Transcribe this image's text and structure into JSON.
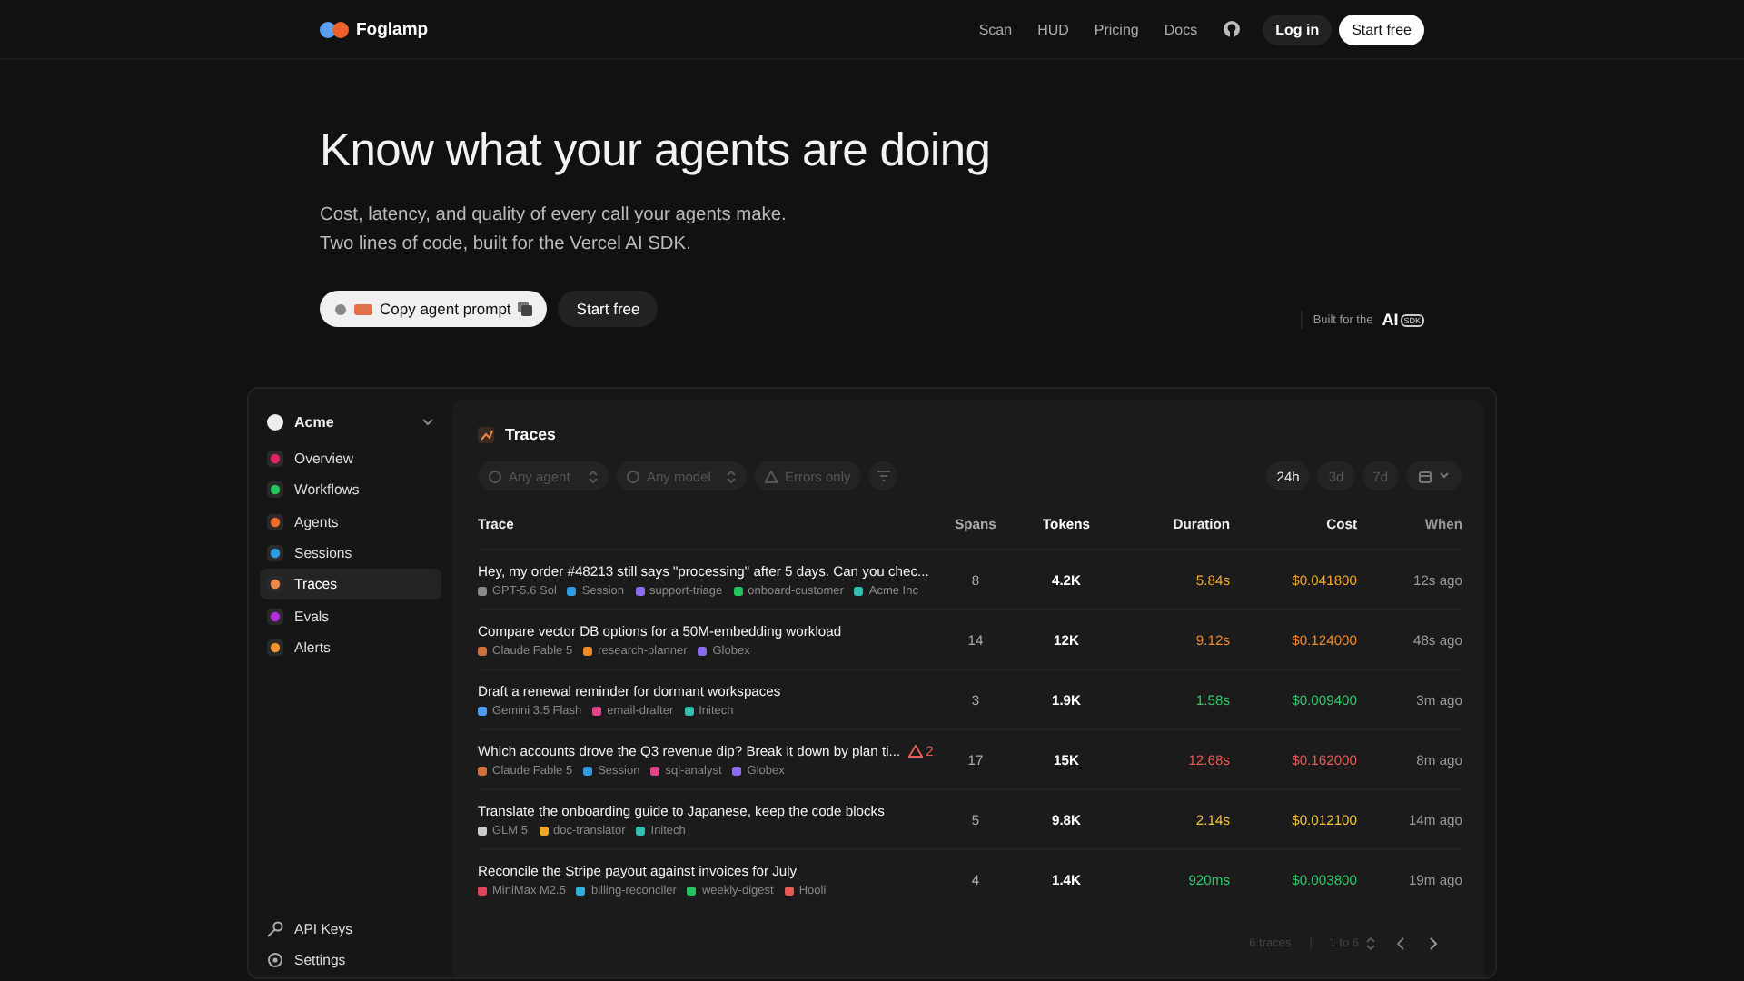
{
  "nav": {
    "brand": "Foglamp",
    "links": [
      "Scan",
      "HUD",
      "Pricing",
      "Docs"
    ],
    "login": "Log in",
    "start": "Start free"
  },
  "hero": {
    "title": "Know what your agents are doing",
    "subtitle": "Cost, latency, and quality of every call your agents make. Two lines of code, built for the Vercel AI SDK.",
    "copy_button": "Copy agent prompt",
    "start_button": "Start free",
    "built_for": "Built for the",
    "sdk_logo": "AI",
    "sdk_badge": "SDK"
  },
  "sidebar": {
    "workspace": "Acme",
    "items": [
      {
        "label": "Overview",
        "color": "#e0245e",
        "selected": false
      },
      {
        "label": "Workflows",
        "color": "#22c55e",
        "selected": false
      },
      {
        "label": "Agents",
        "color": "#f06a2a",
        "selected": false
      },
      {
        "label": "Sessions",
        "color": "#2f9be0",
        "selected": false
      },
      {
        "label": "Traces",
        "color": "#e8884a",
        "selected": true
      },
      {
        "label": "Evals",
        "color": "#b02fd8",
        "selected": false
      },
      {
        "label": "Alerts",
        "color": "#f0932a",
        "selected": false
      }
    ],
    "bottom": [
      "API Keys",
      "Settings"
    ]
  },
  "traces": {
    "title": "Traces",
    "filters": [
      "Any agent",
      "Any model",
      "Errors only"
    ],
    "ranges": [
      {
        "label": "24h",
        "selected": true
      },
      {
        "label": "3d",
        "selected": false
      },
      {
        "label": "7d",
        "selected": false
      }
    ],
    "columns": [
      "Trace",
      "Spans",
      "Tokens",
      "Duration",
      "Cost",
      "When"
    ],
    "rows": [
      {
        "title": "Hey, my order #48213 still says \"processing\" after 5 days. Can you chec...",
        "tags": [
          {
            "label": "GPT-5.6 Sol",
            "color": "#8a8a8a"
          },
          {
            "label": "Session",
            "color": "#2f9be0"
          },
          {
            "label": "support-triage",
            "color": "#8b6cf0"
          },
          {
            "label": "onboard-customer",
            "color": "#22c55e"
          },
          {
            "label": "Acme Inc",
            "color": "#2fc0b0"
          }
        ],
        "spans": "8",
        "tokens": "4.2K",
        "duration": "5.84s",
        "cost": "$0.041800",
        "when": "12s ago",
        "color": "#f0a62a"
      },
      {
        "title": "Compare vector DB options for a 50M-embedding workload",
        "tags": [
          {
            "label": "Claude Fable 5",
            "color": "#d0703a"
          },
          {
            "label": "research-planner",
            "color": "#f08a2a"
          },
          {
            "label": "Globex",
            "color": "#8b6cf0"
          }
        ],
        "spans": "14",
        "tokens": "12K",
        "duration": "9.12s",
        "cost": "$0.124000",
        "when": "48s ago",
        "color": "#ec8a30"
      },
      {
        "title": "Draft a renewal reminder for dormant workspaces",
        "tags": [
          {
            "label": "Gemini 3.5 Flash",
            "color": "#4a9cf0"
          },
          {
            "label": "email-drafter",
            "color": "#e0458a"
          },
          {
            "label": "Initech",
            "color": "#2fc0b0"
          }
        ],
        "spans": "3",
        "tokens": "1.9K",
        "duration": "1.58s",
        "cost": "$0.009400",
        "when": "3m ago",
        "color": "#34c46a"
      },
      {
        "title": "Which accounts drove the Q3 revenue dip? Break it down by plan ti...",
        "warning": "2",
        "tags": [
          {
            "label": "Claude Fable 5",
            "color": "#d0703a"
          },
          {
            "label": "Session",
            "color": "#2f9be0"
          },
          {
            "label": "sql-analyst",
            "color": "#e0458a"
          },
          {
            "label": "Globex",
            "color": "#8b6cf0"
          }
        ],
        "spans": "17",
        "tokens": "15K",
        "duration": "12.68s",
        "cost": "$0.162000",
        "when": "8m ago",
        "color": "#e85a55"
      },
      {
        "title": "Translate the onboarding guide to Japanese, keep the code blocks",
        "tags": [
          {
            "label": "GLM 5",
            "color": "#cccccc"
          },
          {
            "label": "doc-translator",
            "color": "#f0a62a"
          },
          {
            "label": "Initech",
            "color": "#2fc0b0"
          }
        ],
        "spans": "5",
        "tokens": "9.8K",
        "duration": "2.14s",
        "cost": "$0.012100",
        "when": "14m ago",
        "color": "#eec23a"
      },
      {
        "title": "Reconcile the Stripe payout against invoices for July",
        "tags": [
          {
            "label": "MiniMax M2.5",
            "color": "#e0455a"
          },
          {
            "label": "billing-reconciler",
            "color": "#2fb0e0"
          },
          {
            "label": "weekly-digest",
            "color": "#22c55e"
          },
          {
            "label": "Hooli",
            "color": "#e85a55"
          }
        ],
        "spans": "4",
        "tokens": "1.4K",
        "duration": "920ms",
        "cost": "$0.003800",
        "when": "19m ago",
        "color": "#34c46a"
      }
    ],
    "footer": {
      "count": "6 traces",
      "range": "1 to 6"
    }
  }
}
